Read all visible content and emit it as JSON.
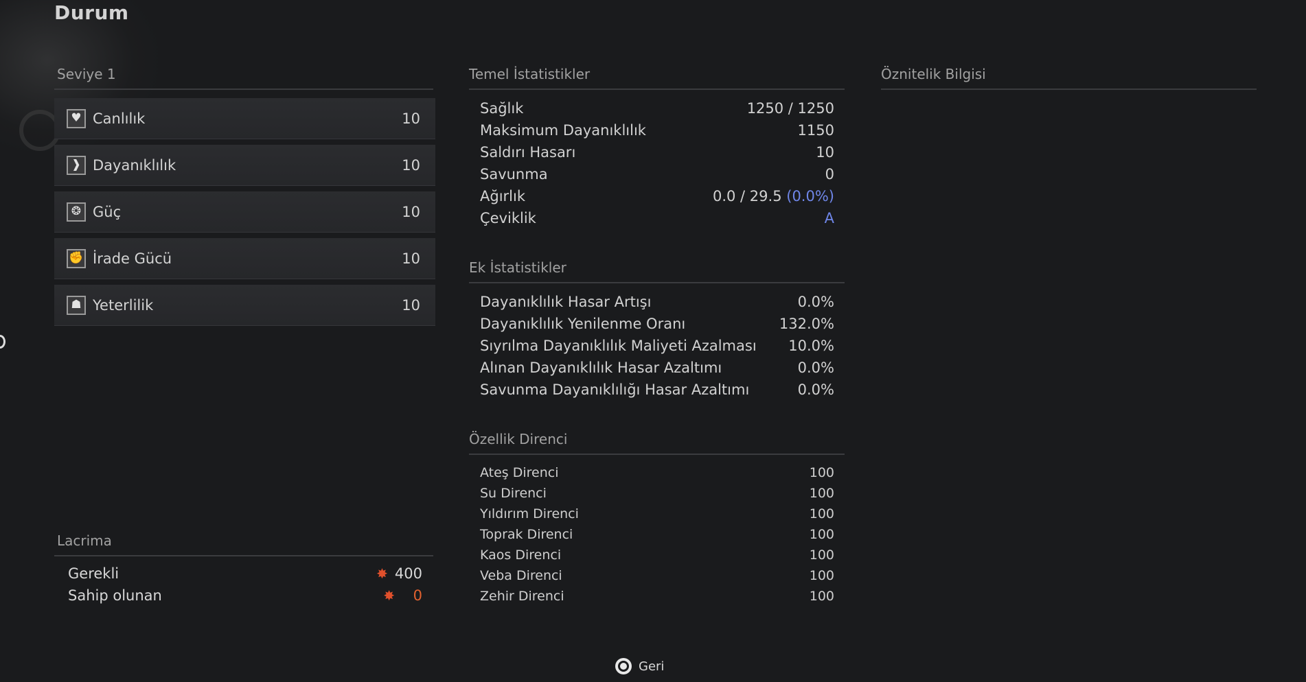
{
  "page": {
    "title": "Durum"
  },
  "level": {
    "heading": "Seviye 1"
  },
  "attributes": [
    {
      "icon": "heart-icon",
      "label": "Canlılık",
      "value": "10"
    },
    {
      "icon": "leg-icon",
      "label": "Dayanıklılık",
      "value": "10"
    },
    {
      "icon": "flexed-arm-icon",
      "label": "Güç",
      "value": "10"
    },
    {
      "icon": "fist-icon",
      "label": "İrade Gücü",
      "value": "10"
    },
    {
      "icon": "figure-icon",
      "label": "Yeterlilik",
      "value": "10"
    }
  ],
  "lacrima": {
    "heading": "Lacrima",
    "required_label": "Gerekli",
    "required_value": "400",
    "owned_label": "Sahip olunan",
    "owned_value": "0",
    "icon": "lacrima-spark-icon"
  },
  "basic_stats": {
    "heading": "Temel İstatistikler",
    "rows": [
      {
        "label": "Sağlık",
        "value": "1250 / 1250"
      },
      {
        "label": "Maksimum Dayanıklılık",
        "value": "1150"
      },
      {
        "label": "Saldırı Hasarı",
        "value": "10"
      },
      {
        "label": "Savunma",
        "value": "0"
      },
      {
        "label": "Ağırlık",
        "value": "0.0 / 29.5",
        "extra": "(0.0%)"
      },
      {
        "label": "Çeviklik",
        "value": "A"
      }
    ]
  },
  "extra_stats": {
    "heading": "Ek İstatistikler",
    "rows": [
      {
        "label": "Dayanıklılık Hasar Artışı",
        "value": "0.0%"
      },
      {
        "label": "Dayanıklılık Yenilenme Oranı",
        "value": "132.0%"
      },
      {
        "label": "Sıyrılma Dayanıklılık Maliyeti Azalması",
        "value": "10.0%"
      },
      {
        "label": "Alınan Dayanıklılık Hasar Azaltımı",
        "value": "0.0%"
      },
      {
        "label": "Savunma Dayanıklılığı Hasar Azaltımı",
        "value": "0.0%"
      }
    ]
  },
  "resistances": {
    "heading": "Özellik Direnci",
    "rows": [
      {
        "label": "Ateş Direnci",
        "value": "100"
      },
      {
        "label": "Su Direnci",
        "value": "100"
      },
      {
        "label": "Yıldırım Direnci",
        "value": "100"
      },
      {
        "label": "Toprak Direnci",
        "value": "100"
      },
      {
        "label": "Kaos Direnci",
        "value": "100"
      },
      {
        "label": "Veba Direnci",
        "value": "100"
      },
      {
        "label": "Zehir Direnci",
        "value": "100"
      }
    ]
  },
  "attribute_info": {
    "heading": "Öznitelik Bilgisi"
  },
  "footer": {
    "back_label": "Geri",
    "back_icon": "circle-button-icon"
  },
  "colors": {
    "accent_blue": "#6f86e8",
    "warning_orange": "#e2612f"
  }
}
